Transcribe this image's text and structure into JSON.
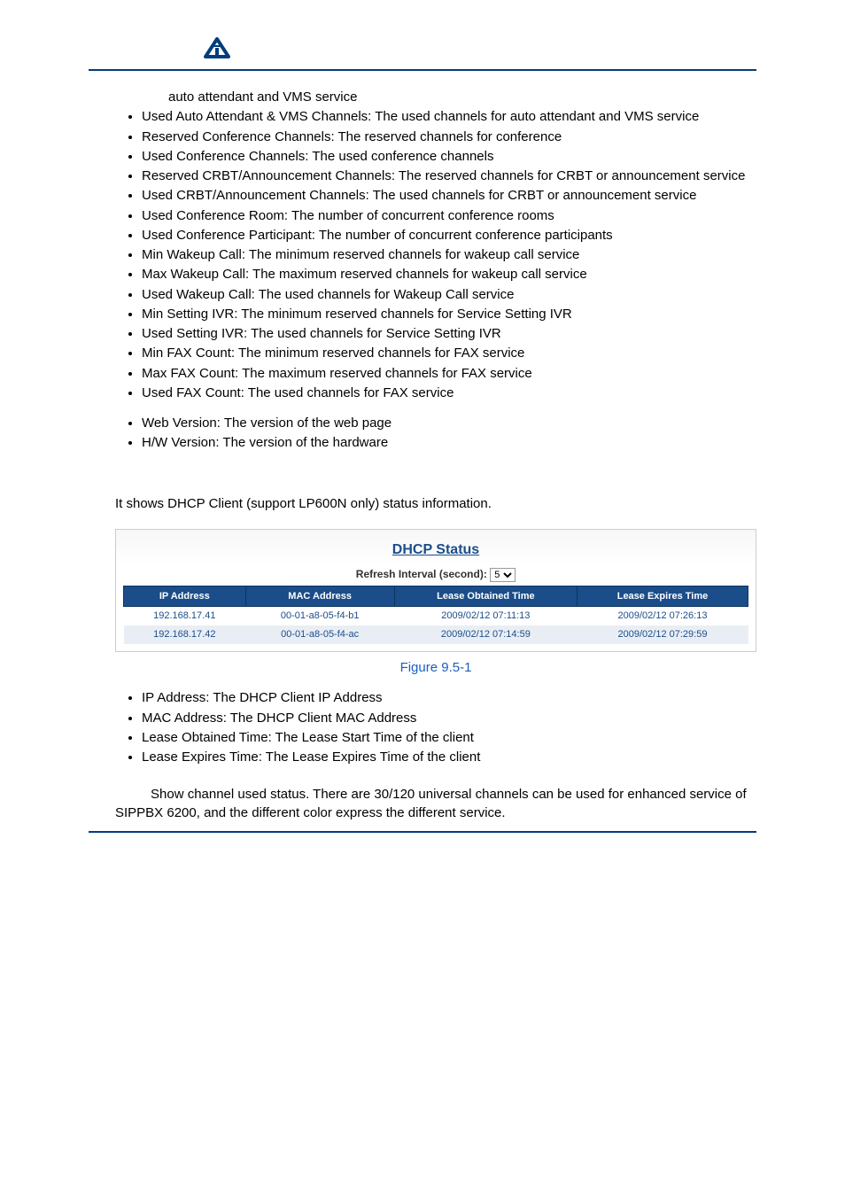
{
  "intro_first_line": "auto attendant and VMS service",
  "bullets_main": [
    "Used Auto Attendant & VMS Channels: The used channels for auto attendant and VMS service",
    "Reserved Conference Channels: The reserved channels for conference",
    "Used Conference Channels: The used conference channels",
    "Reserved CRBT/Announcement Channels: The reserved channels for CRBT or announcement service",
    "Used CRBT/Announcement Channels: The used channels for CRBT or announcement service",
    "Used Conference Room: The number of concurrent conference rooms",
    "Used Conference Participant: The number of concurrent conference participants",
    "Min Wakeup Call: The minimum reserved channels for wakeup call service",
    "Max Wakeup Call: The maximum reserved channels for wakeup call service",
    "Used Wakeup Call: The used channels for Wakeup Call service",
    "Min Setting IVR: The minimum reserved channels for Service Setting IVR",
    "Used Setting IVR: The used channels for Service Setting IVR",
    "Min FAX Count: The minimum reserved channels for FAX service",
    "Max FAX Count: The maximum reserved channels for FAX service",
    "Used FAX Count: The used channels for FAX service"
  ],
  "bullets_version": [
    "Web Version: The version of the web page",
    "H/W Version: The version of the hardware"
  ],
  "dhcp_intro": "It shows DHCP Client (support LP600N only) status information.",
  "dhcp_title": "DHCP Status",
  "refresh_label": "Refresh Interval (second):",
  "refresh_value": "5",
  "table": {
    "headers": [
      "IP Address",
      "MAC Address",
      "Lease Obtained Time",
      "Lease Expires Time"
    ],
    "rows": [
      [
        "192.168.17.41",
        "00-01-a8-05-f4-b1",
        "2009/02/12 07:11:13",
        "2009/02/12 07:26:13"
      ],
      [
        "192.168.17.42",
        "00-01-a8-05-f4-ac",
        "2009/02/12 07:14:59",
        "2009/02/12 07:29:59"
      ]
    ]
  },
  "figure_caption": "Figure 9.5-1",
  "bullets_fields": [
    "IP Address: The DHCP Client IP Address",
    "MAC Address: The DHCP Client MAC Address",
    "Lease Obtained Time: The Lease Start Time of the client",
    "Lease Expires Time: The Lease Expires Time of the client"
  ],
  "closing_text": "Show channel used status. There are 30/120 universal channels can be used for enhanced service of SIPPBX 6200, and the different color express the different service."
}
